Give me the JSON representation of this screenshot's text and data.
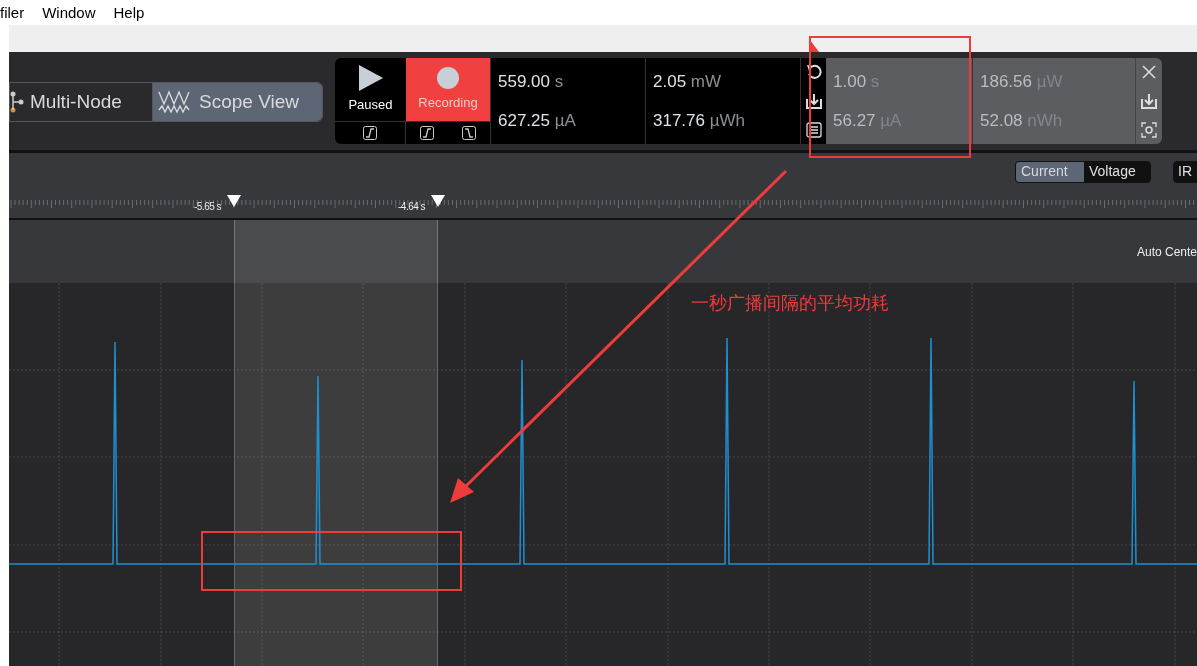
{
  "menu": [
    "filer",
    "Window",
    "Help"
  ],
  "view_tabs": [
    {
      "label": "Multi-Node",
      "selected": false
    },
    {
      "label": "Scope View",
      "selected": true
    }
  ],
  "transport": {
    "paused_label": "Paused",
    "recording_label": "Recording",
    "recording": true
  },
  "stats": [
    {
      "value": "559.00",
      "unit": "s"
    },
    {
      "value": "627.25",
      "unit": "µA"
    },
    {
      "value": "2.05",
      "unit": "mW"
    },
    {
      "value": "317.76",
      "unit": "µWh"
    }
  ],
  "selection_stats": [
    {
      "value": "1.00",
      "unit": "s"
    },
    {
      "value": "56.27",
      "unit": "µA"
    },
    {
      "value": "186.56",
      "unit": "µW"
    },
    {
      "value": "52.08",
      "unit": "nWh"
    }
  ],
  "mode_toggle": [
    {
      "label": "Current",
      "selected": true
    },
    {
      "label": "Voltage",
      "selected": false
    }
  ],
  "irc_button": "IR",
  "markers": [
    "-5.65 s",
    "-4.64 s"
  ],
  "auto_center": "Auto Cente",
  "annotation": "一秒广播间隔的平均功耗"
}
